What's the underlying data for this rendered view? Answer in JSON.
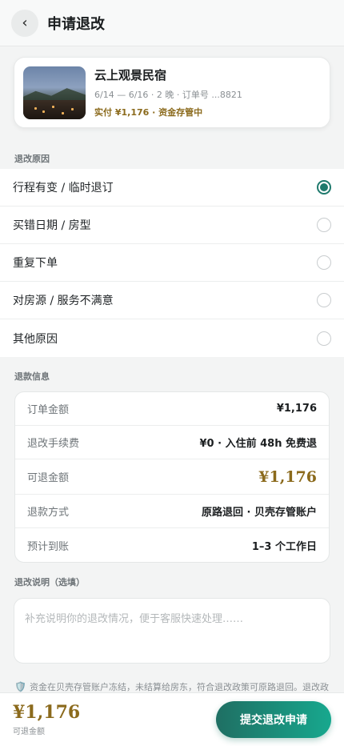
{
  "header": {
    "back_icon": "‹",
    "title": "申请退改"
  },
  "order": {
    "hotel_name": "云上观景民宿",
    "meta": "6/14 — 6/16 · 2 晚 · 订单号 ...8821",
    "paid": "实付 ¥1,176 · 资金存管中"
  },
  "reasons": {
    "label": "退改原因",
    "items": [
      {
        "label": "行程有变 / 临时退订",
        "selected": true
      },
      {
        "label": "买错日期 / 房型",
        "selected": false
      },
      {
        "label": "重复下单",
        "selected": false
      },
      {
        "label": "对房源 / 服务不满意",
        "selected": false
      },
      {
        "label": "其他原因",
        "selected": false
      }
    ]
  },
  "refund": {
    "label": "退款信息",
    "rows": [
      {
        "label": "订单金额",
        "value": "¥1,176"
      },
      {
        "label": "退改手续费",
        "value": "¥0 · 入住前 48h 免费退"
      },
      {
        "label": "可退金额",
        "value": "¥1,176"
      },
      {
        "label": "退款方式",
        "value": "原路退回 · 贝壳存管账户"
      },
      {
        "label": "预计到账",
        "value": "1–3 个工作日"
      }
    ]
  },
  "note": {
    "label": "退改说明（选填）",
    "placeholder": "补充说明你的退改情况，便于客服快速处理……"
  },
  "notice": "资金在贝壳存管账户冻结，未结算给房东，符合退改政策可原路退回。退改政",
  "footer": {
    "amount": "¥1,176",
    "amount_label": "可退金额",
    "submit_label": "提交退改申请"
  },
  "colors": {
    "accent": "#1f7a6d",
    "gold": "#8b6a1c"
  }
}
